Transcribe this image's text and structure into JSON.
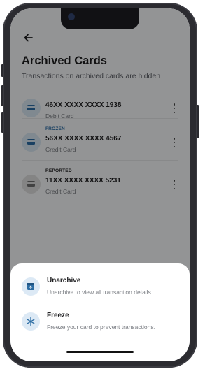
{
  "header": {
    "title": "Archived Cards",
    "subtitle": "Transactions on archived cards are hidden"
  },
  "cards": [
    {
      "status": "",
      "number": "46XX XXXX XXXX 1938",
      "type": "Debit Card"
    },
    {
      "status": "FROZEN",
      "number": "56XX XXXX XXXX 4567",
      "type": "Credit Card"
    },
    {
      "status": "REPORTED",
      "number": "11XX XXXX XXXX 5231",
      "type": "Credit Card"
    }
  ],
  "sheet": {
    "options": [
      {
        "title": "Unarchive",
        "description": "Unarchive to view all transaction details",
        "icon": "archive-box-icon"
      },
      {
        "title": "Freeze",
        "description": "Freeze your card to prevent transactions.",
        "icon": "snowflake-icon"
      }
    ]
  },
  "colors": {
    "accent": "#2b6ca3",
    "frozen": "#2b6ca3",
    "reported": "#1d1d1f",
    "overlay": "rgba(0,0,0,0.40)"
  }
}
